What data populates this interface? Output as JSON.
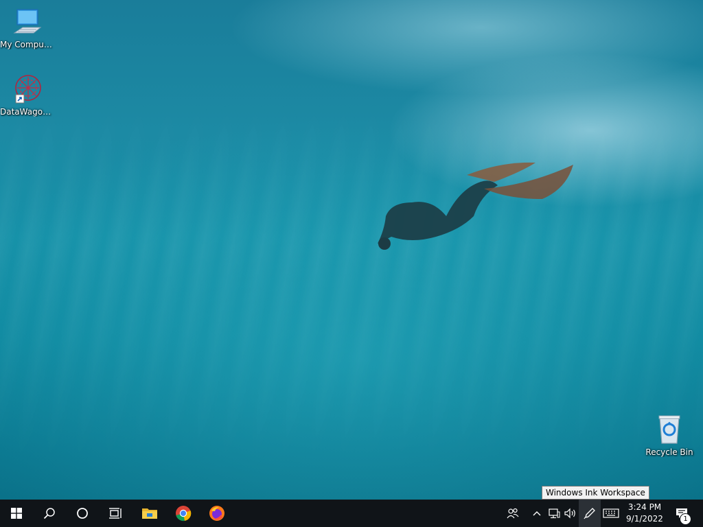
{
  "desktop": {
    "icons": [
      {
        "label": "My Computer"
      },
      {
        "label": "DataWagon..."
      },
      {
        "label": "Recycle Bin"
      }
    ]
  },
  "taskbar": {
    "apps": [
      "start-icon",
      "search-icon",
      "cortana-icon",
      "task-view-icon",
      "file-explorer-icon",
      "chrome-icon",
      "firefox-icon"
    ],
    "clock": {
      "time": "3:24 PM",
      "date": "9/1/2022"
    },
    "tooltip": "Windows Ink Workspace",
    "notification_count": "1"
  },
  "colors": {
    "taskbar": "#101418",
    "accent": "#0a78d4"
  }
}
